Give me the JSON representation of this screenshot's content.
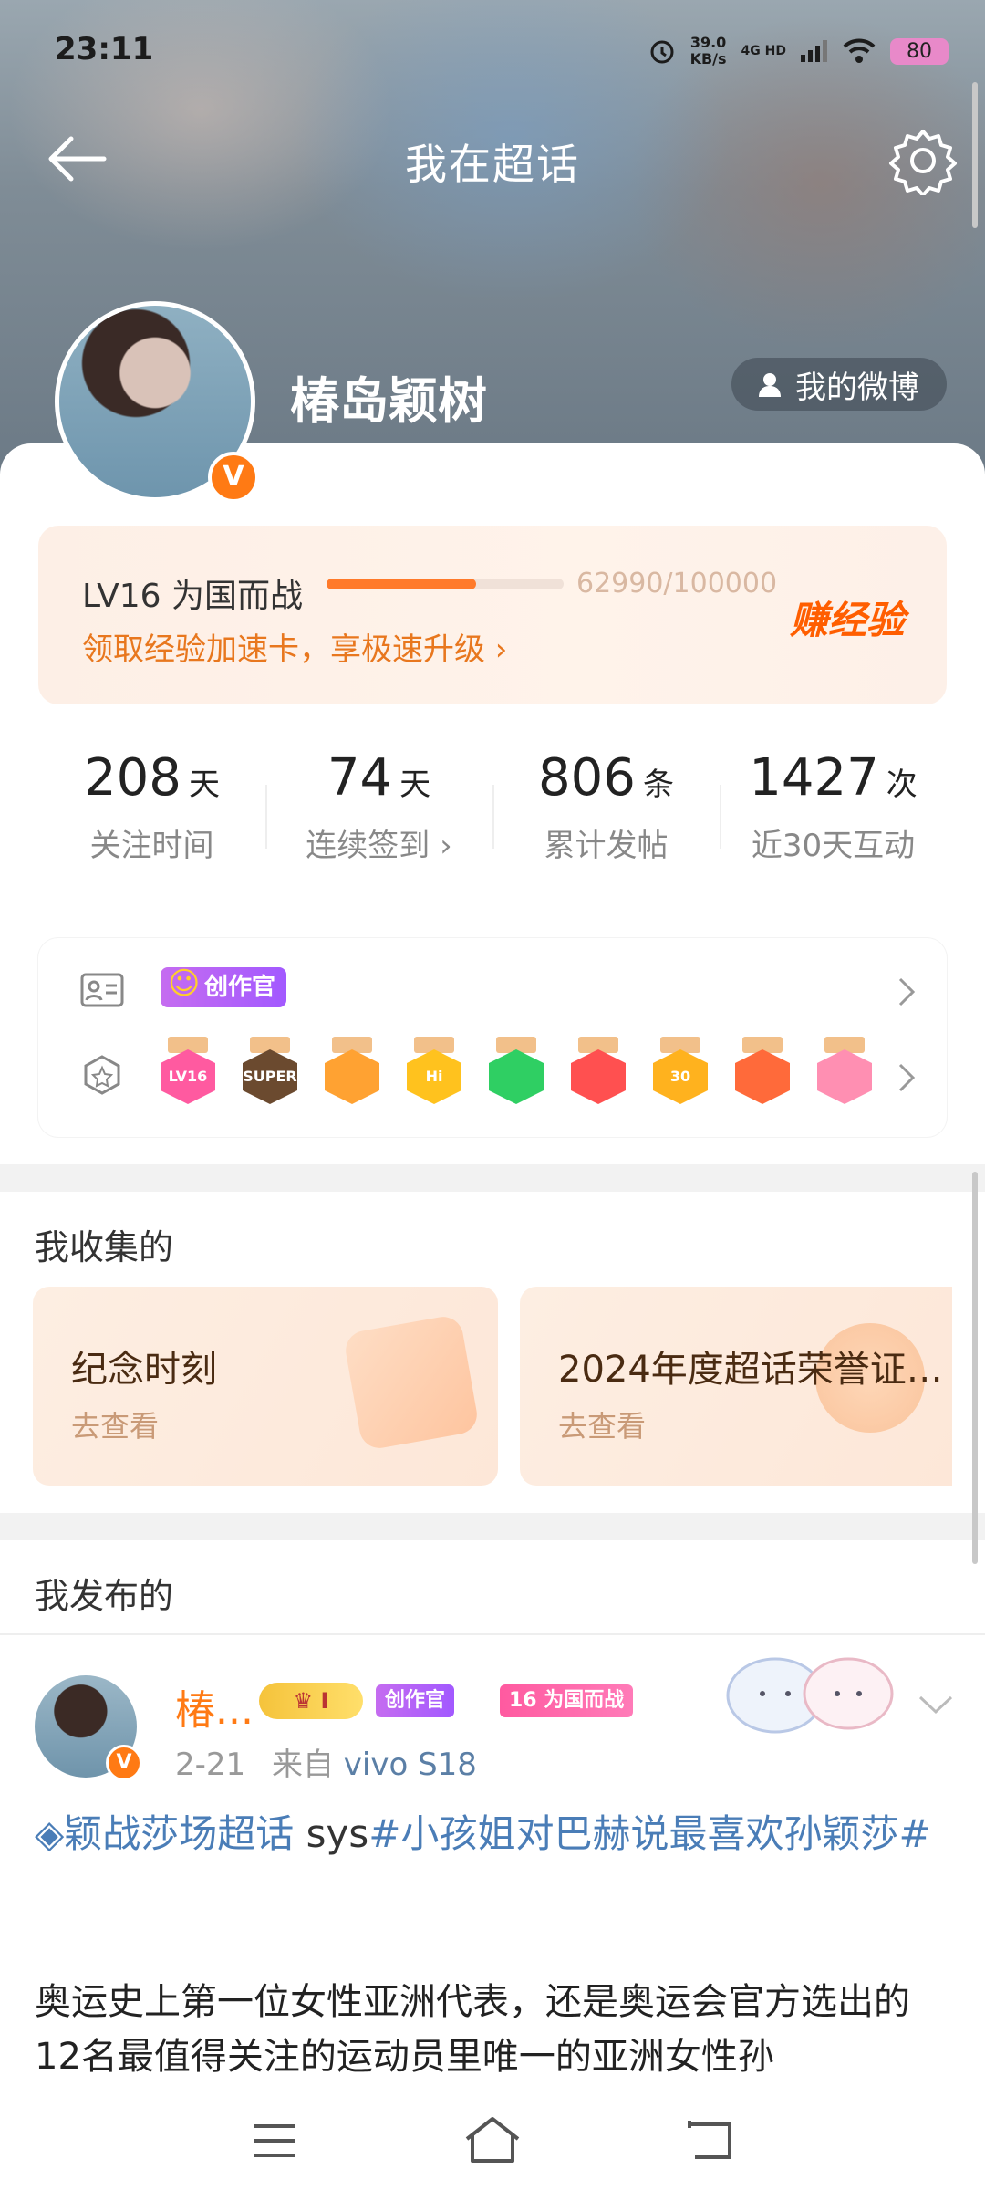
{
  "status_bar": {
    "time": "23:11",
    "net_speed_value": "39.0",
    "net_speed_unit": "KB/s",
    "network": "4G HD",
    "battery": "80"
  },
  "nav": {
    "title": "我在超话"
  },
  "profile": {
    "name": "椿岛颖树",
    "my_weibo_label": "我的微博",
    "verified_badge": "V"
  },
  "level": {
    "label": "LV16 为国而战",
    "progress": "62990/100000",
    "progress_fraction": 0.6299,
    "upgrade_link": "领取经验加速卡，享极速升级 ›",
    "earn_label": "赚经验"
  },
  "stats": [
    {
      "value": "208",
      "unit": "天",
      "label": "关注时间"
    },
    {
      "value": "74",
      "unit": "天",
      "label": "连续签到 ›"
    },
    {
      "value": "806",
      "unit": "条",
      "label": "累计发帖"
    },
    {
      "value": "1427",
      "unit": "次",
      "label": "近30天互动"
    }
  ],
  "honors": {
    "creator_badge": "创作官",
    "medals": [
      {
        "text": "LV16",
        "color": "#ff5aa0"
      },
      {
        "text": "SUPER",
        "color": "#6b4a2f"
      },
      {
        "text": "",
        "color": "#ffa232"
      },
      {
        "text": "Hi",
        "color": "#ffc21e"
      },
      {
        "text": "",
        "color": "#2fcf63"
      },
      {
        "text": "",
        "color": "#ff5050"
      },
      {
        "text": "30",
        "color": "#ffb21e"
      },
      {
        "text": "",
        "color": "#ff6a3a"
      },
      {
        "text": "",
        "color": "#ff8fb2"
      }
    ]
  },
  "collected": {
    "title": "我收集的",
    "items": [
      {
        "title": "纪念时刻",
        "sub": "去查看"
      },
      {
        "title": "2024年度超话荣誉证…",
        "sub": "去查看"
      }
    ]
  },
  "published": {
    "title": "我发布的"
  },
  "post": {
    "author": "椿...",
    "crown_badge_text": "I",
    "creator_badge": "创作官",
    "level_badge": "16 为国而战",
    "date": "2-21",
    "from_prefix": "来自",
    "source": "vivo S18",
    "topic_link": "◈颖战莎场超话",
    "topic_text": " sys",
    "hashtag": "#小孩姐对巴赫说最喜欢孙颖莎#",
    "body": "奥运史上第一位女性亚洲代表，还是奥运会官方选出的12名最值得关注的运动员里唯一的亚洲女性孙"
  },
  "colors": {
    "accent": "#ff7a14",
    "link": "#4a7db7"
  }
}
